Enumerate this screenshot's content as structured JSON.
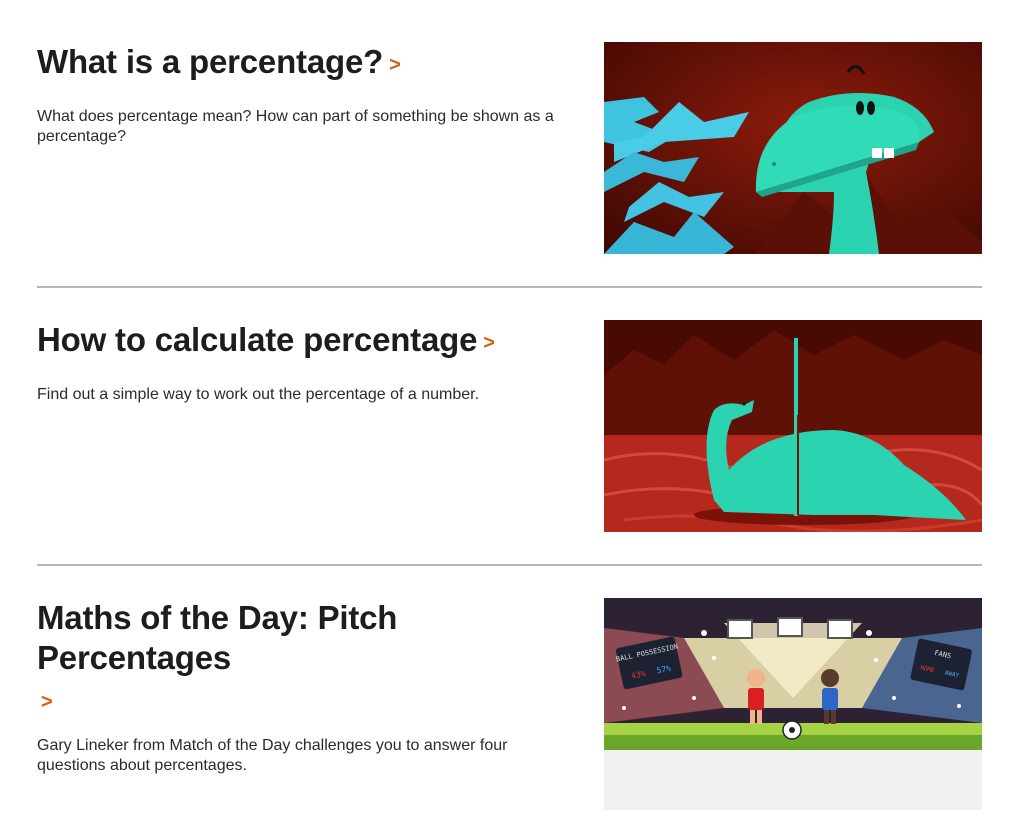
{
  "items": [
    {
      "title": "What is a percentage?",
      "chevron": ">",
      "description": "What does percentage mean? How can part of something be shown as a percentage?"
    },
    {
      "title": "How to calculate percentage",
      "chevron": ">",
      "description": "Find out a simple way to work out the percentage of a number."
    },
    {
      "title": "Maths of the Day: Pitch Percentages",
      "chevron": ">",
      "description": "Gary Lineker from Match of the Day challenges you to answer four questions about percentages."
    }
  ],
  "scoreboard_left": {
    "label": "BALL POSSESSION",
    "home": "43%",
    "away": "57%"
  },
  "scoreboard_right": {
    "label": "FANS",
    "home": "HOME",
    "away": "AWAY"
  },
  "colors": {
    "accent": "#d35f0f",
    "dino": "#2cd3b1",
    "leaf": "#3fc4e0",
    "lava": "#b5281d"
  }
}
